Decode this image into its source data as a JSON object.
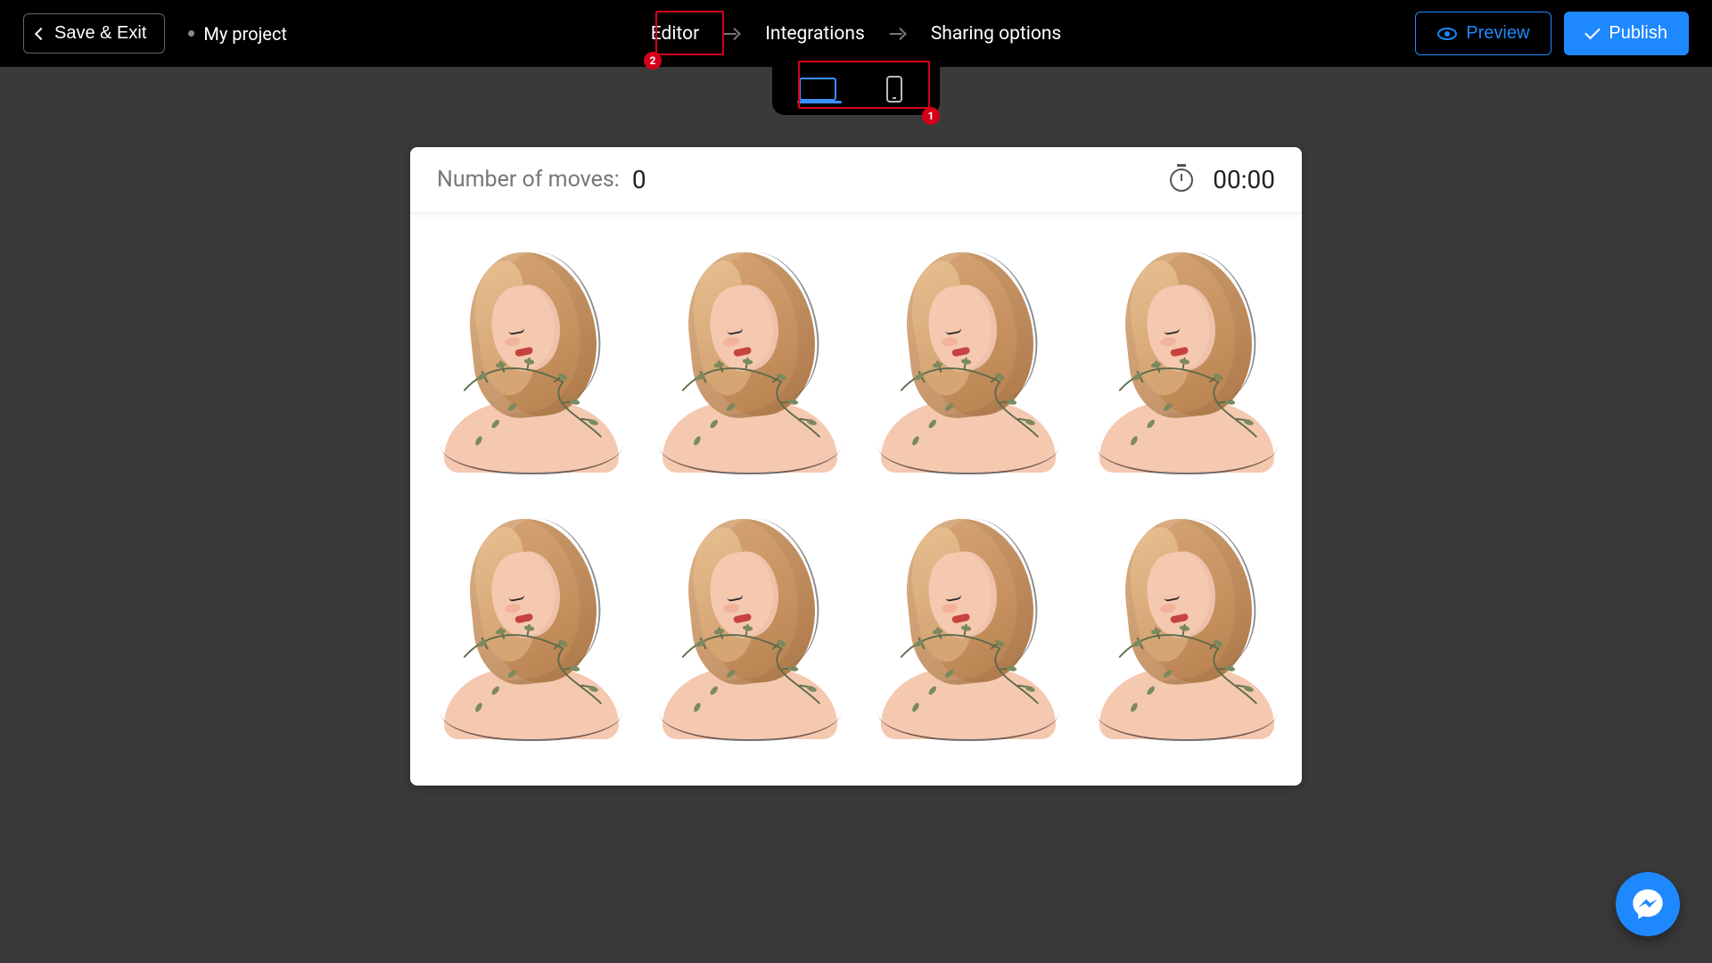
{
  "header": {
    "save_exit": "Save & Exit",
    "project_name": "My project",
    "nav": {
      "editor": "Editor",
      "integrations": "Integrations",
      "sharing": "Sharing options"
    },
    "preview": "Preview",
    "publish": "Publish"
  },
  "device_switcher": {
    "active": "desktop"
  },
  "annotations": {
    "badge1": "1",
    "badge2": "2"
  },
  "game": {
    "moves_label": "Number of moves:",
    "moves_value": "0",
    "timer_value": "00:00",
    "card_count": 8
  },
  "colors": {
    "accent": "#1e88ff",
    "highlight": "#d4001a",
    "bg": "#3a3a3a"
  }
}
